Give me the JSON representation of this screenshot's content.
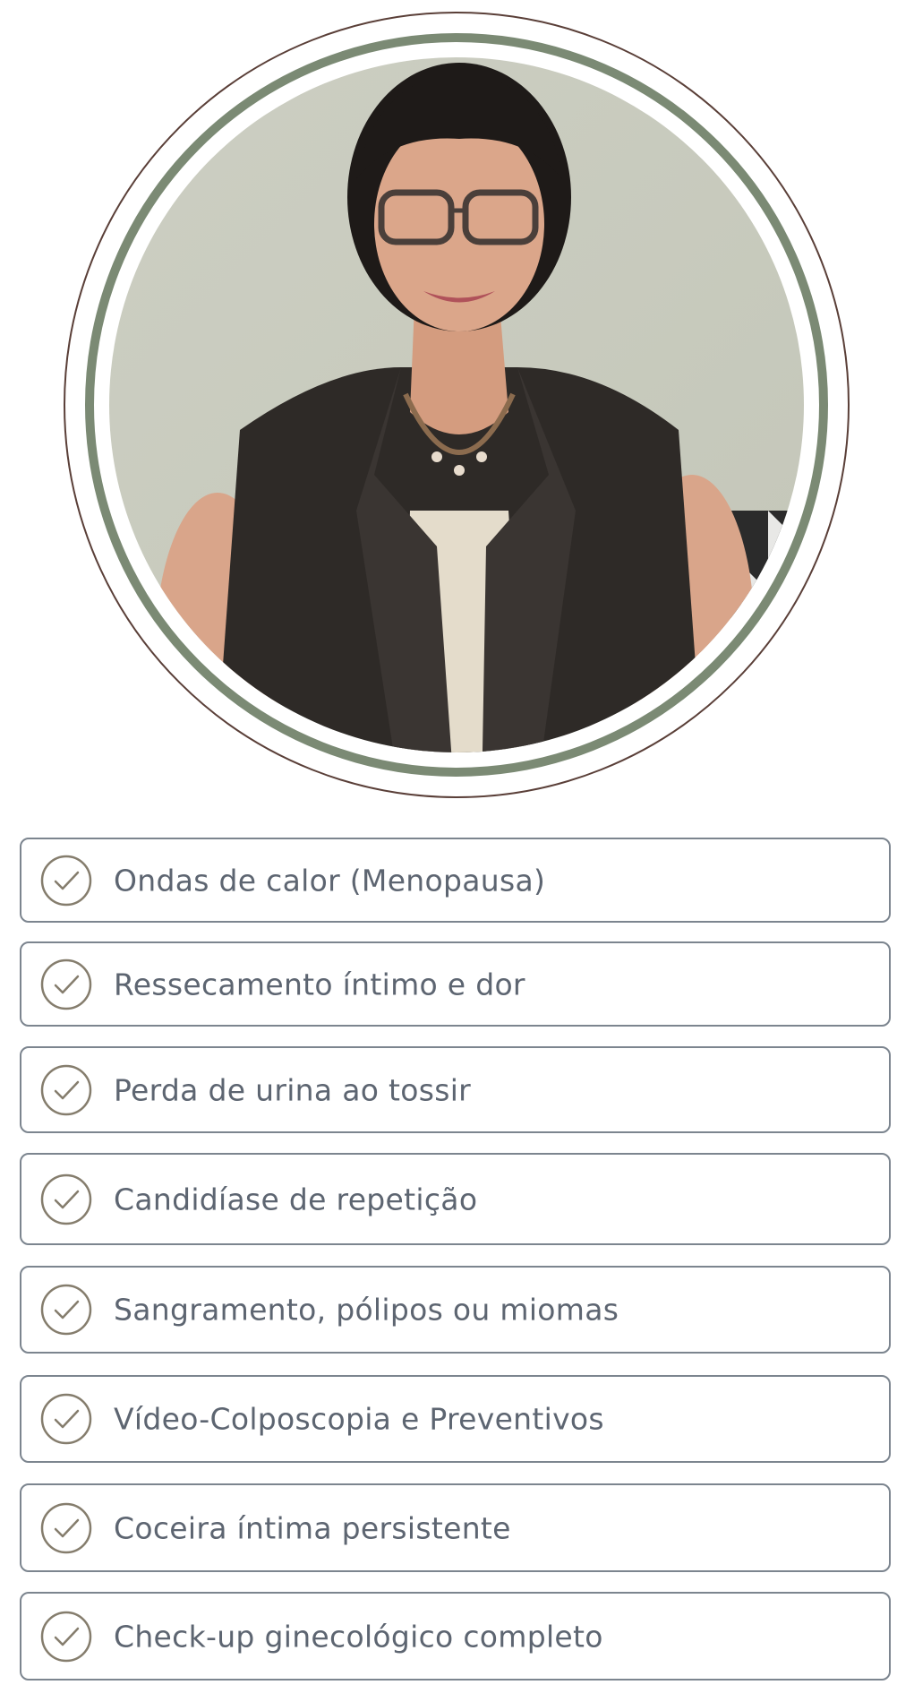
{
  "portrait": {
    "alt": "Portrait of doctor",
    "ring_outer_color": "#5a3f38",
    "ring_inner_color": "#7b8a74",
    "background_color": "#c9cbbe"
  },
  "check_icon": {
    "color": "#857d6d"
  },
  "items": [
    {
      "label": "Ondas de calor (Menopausa)"
    },
    {
      "label": "Ressecamento íntimo e dor"
    },
    {
      "label": "Perda de urina ao tossir"
    },
    {
      "label": "Candidíase de repetição"
    },
    {
      "label": "Sangramento, pólipos ou miomas"
    },
    {
      "label": "Vídeo-Colposcopia e Preventivos"
    },
    {
      "label": "Coceira íntima persistente"
    },
    {
      "label": "Check-up ginecológico completo"
    }
  ]
}
